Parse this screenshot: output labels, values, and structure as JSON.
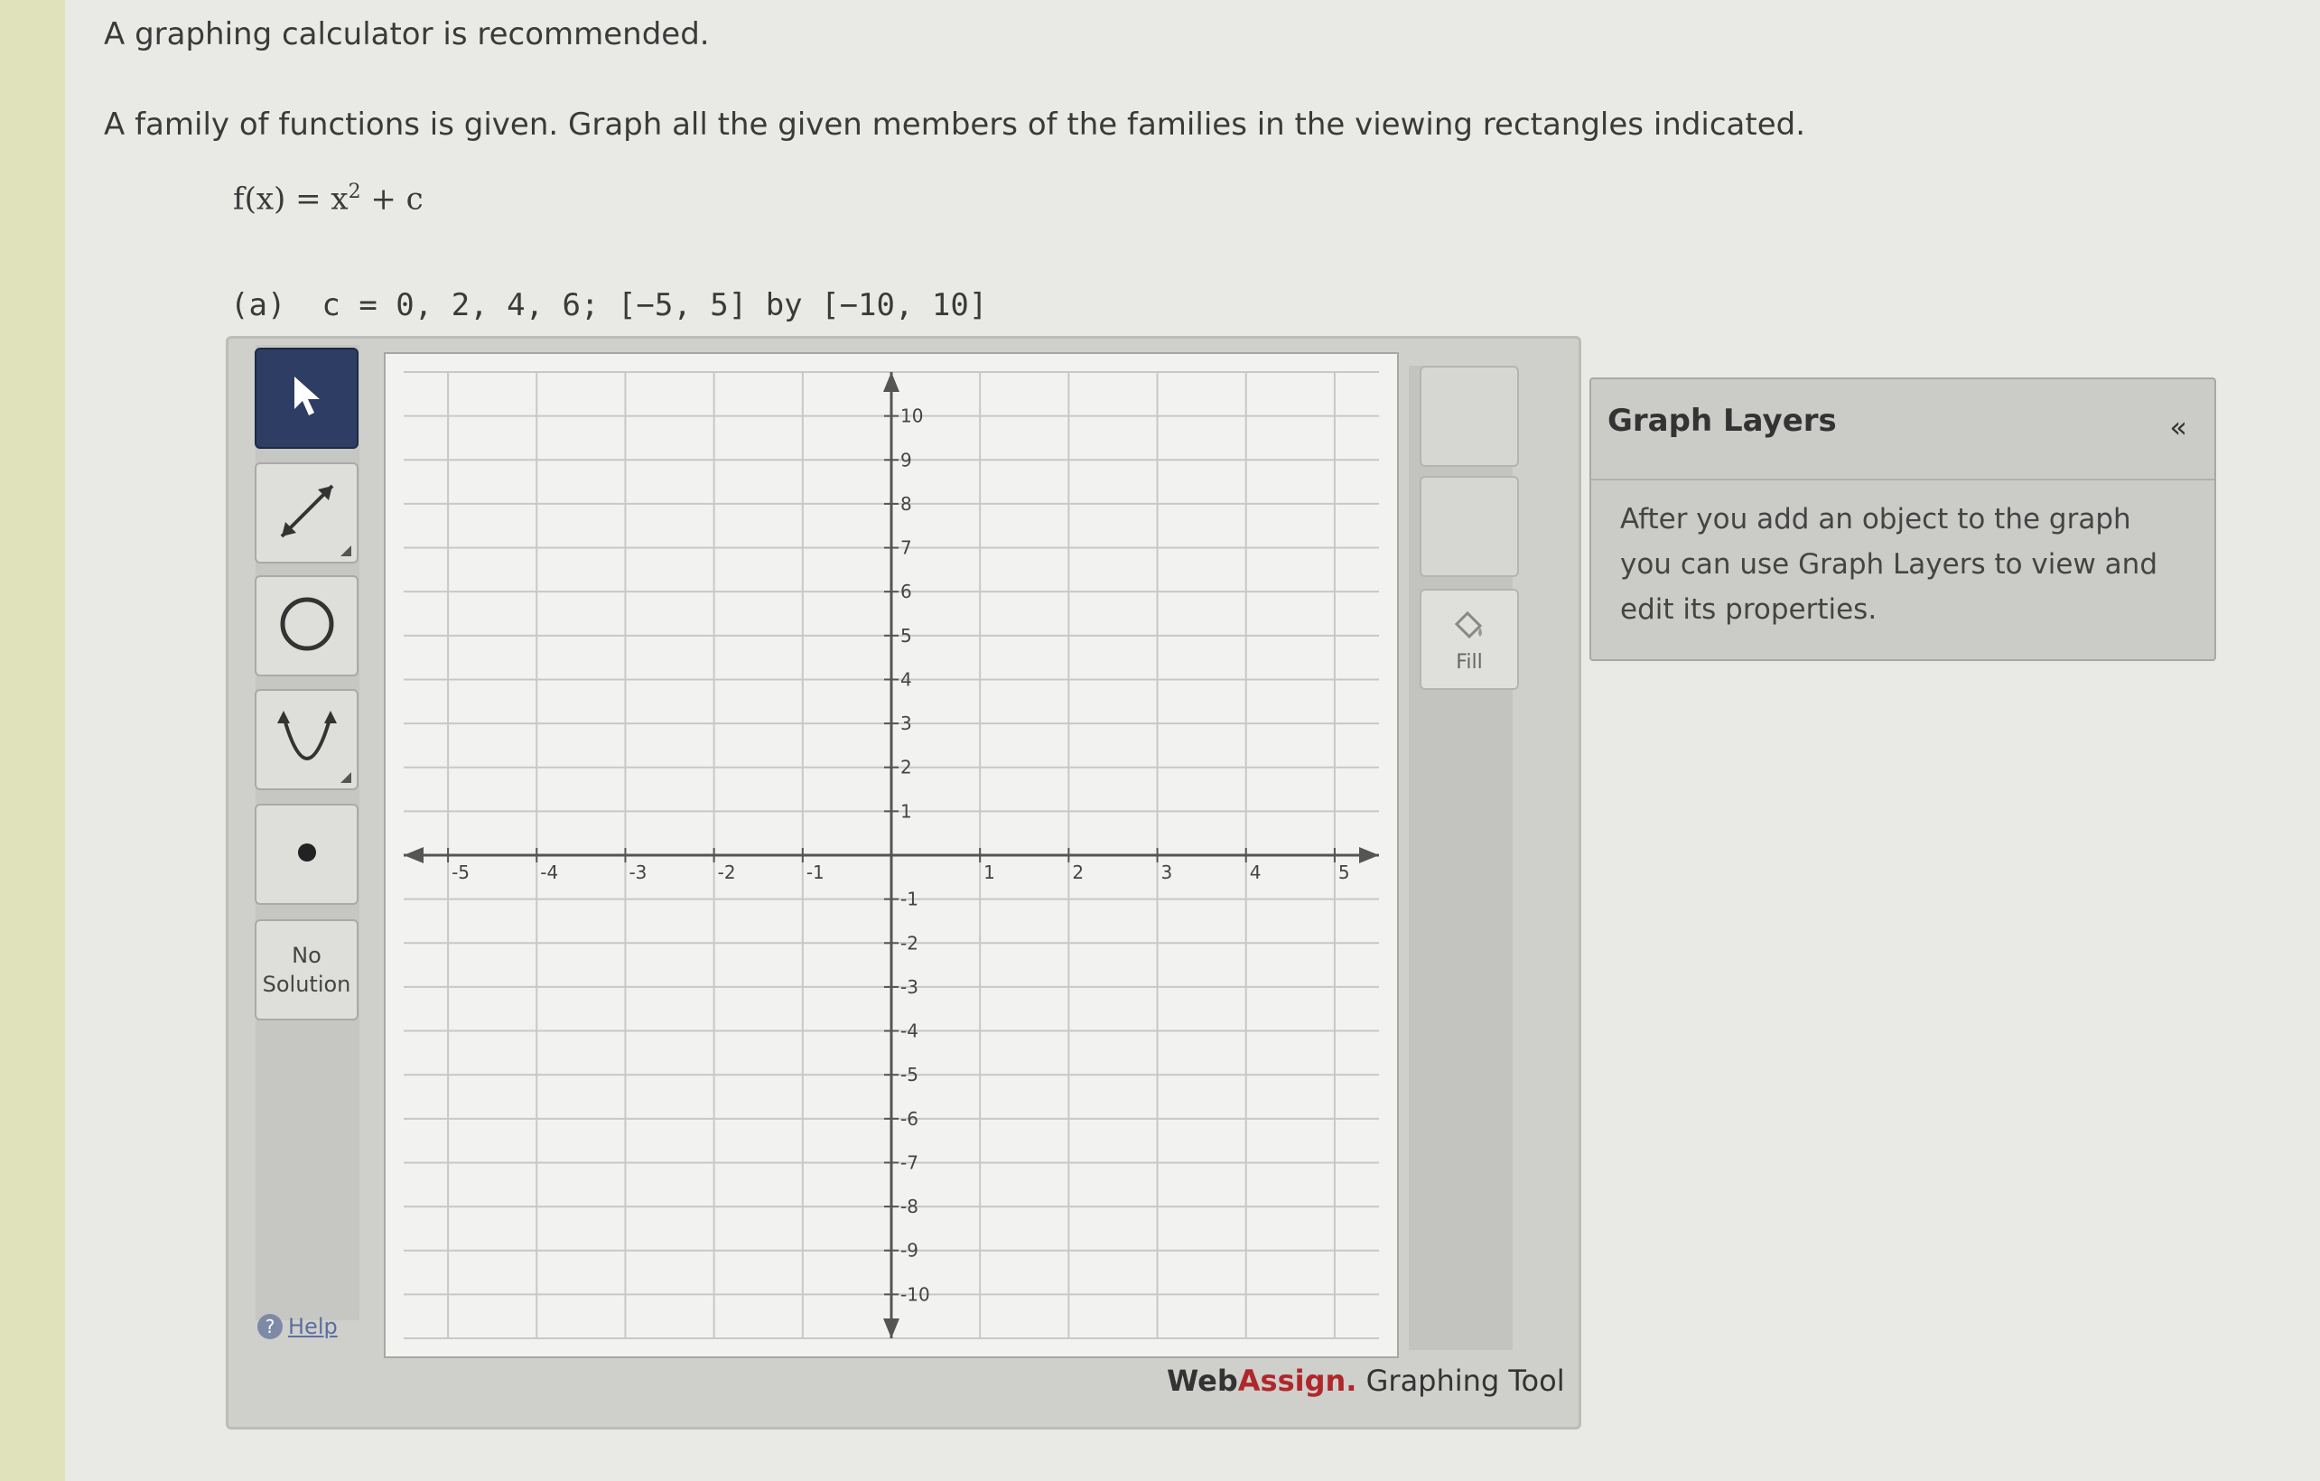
{
  "intro": "A graphing calculator is recommended.",
  "question": "A family of functions is given. Graph all the given members of the families in the viewing rectangles indicated.",
  "function": {
    "lhs": "f(x) = x",
    "exp": "2",
    "rhs": " + c"
  },
  "part_a": {
    "label": "(a)",
    "text": "c = 0, 2, 4, 6; [−5, 5] by [−10, 10]"
  },
  "tools": {
    "pointer": "pointer-arrow-icon",
    "line": "line-segment-icon",
    "circle": "circle-icon",
    "parabola": "parabola-icon",
    "point": "point-icon",
    "no_solution_line1": "No",
    "no_solution_line2": "Solution",
    "help": "Help"
  },
  "side": {
    "fill_label": "Fill"
  },
  "brand": {
    "web": "Web",
    "assign": "Assign.",
    "rest": " Graphing Tool"
  },
  "graph_layers": {
    "title": "Graph Layers",
    "collapse": "«",
    "message": "After you add an object to the graph you can use Graph Layers to view and edit its properties."
  },
  "colors": {
    "active_tool": "#2d3d63",
    "brand_red": "#b0272b"
  },
  "chart_data": {
    "type": "scatter",
    "xlim": [
      -5.5,
      5.5
    ],
    "ylim": [
      -11,
      11
    ],
    "x_ticks": [
      "-5",
      "-4",
      "-3",
      "-2",
      "-1",
      "1",
      "2",
      "3",
      "4",
      "5"
    ],
    "y_ticks": [
      "10",
      "9",
      "8",
      "7",
      "6",
      "5",
      "4",
      "3",
      "2",
      "1",
      "-1",
      "-2",
      "-3",
      "-4",
      "-5",
      "-6",
      "-7",
      "-8",
      "-9",
      "-10"
    ],
    "grid": true,
    "series": []
  }
}
